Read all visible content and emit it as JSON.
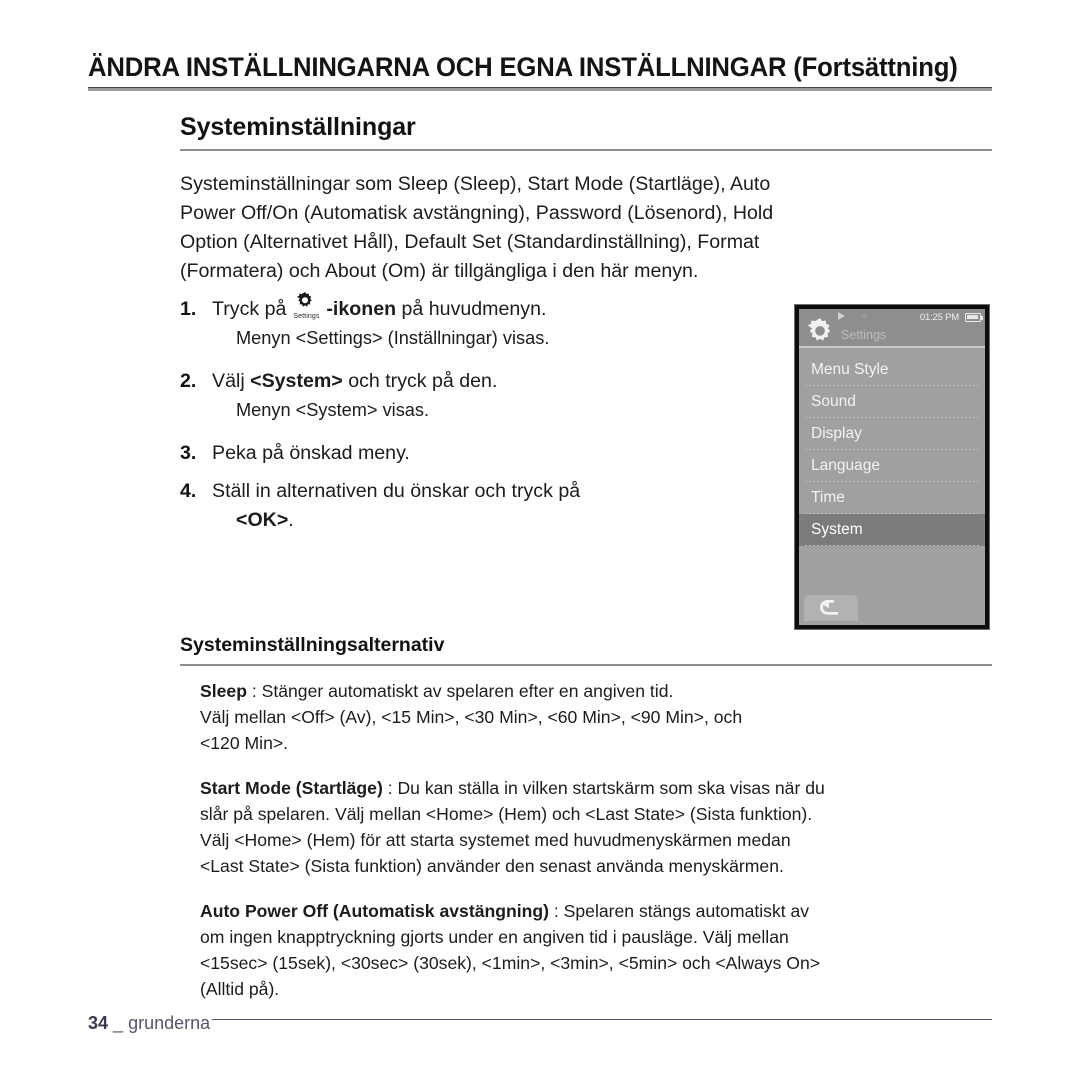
{
  "chapter": {
    "title": "ÄNDRA INSTÄLLNINGARNA OCH EGNA INSTÄLLNINGAR (Fortsättning)"
  },
  "section": {
    "heading": "Systeminställningar",
    "intro_lines": [
      "Systeminställningar som Sleep (Sleep), Start Mode (Startläge), Auto",
      "Power Off/On (Automatisk avstängning), Password (Lösenord), Hold",
      "Option (Alternativet Håll), Default Set (Standardinställning), Format",
      "(Formatera) och About (Om) är tillgängliga i den här menyn."
    ]
  },
  "steps": [
    {
      "num": "1.",
      "text_before": "Tryck på",
      "icon_caption": "Settings",
      "text_bold": "-ikonen",
      "text_after": "på huvudmenyn.",
      "sub": "Menyn <Settings> (Inställningar) visas."
    },
    {
      "num": "2.",
      "text_before": "Välj",
      "text_bold": "<System>",
      "text_after": "och tryck på den.",
      "sub": "Menyn <System> visas."
    },
    {
      "num": "3.",
      "text_before": "Peka på önskad meny.",
      "text_bold": "",
      "text_after": "",
      "sub": ""
    },
    {
      "num": "4.",
      "text_before": "Ställ in alternativen du önskar och tryck på",
      "text_bold": "<OK>",
      "text_after": ".",
      "sub": ""
    }
  ],
  "device": {
    "status": {
      "time": "01:25 PM",
      "play_icon": "play-icon",
      "bluetooth_icon": "bluetooth-icon",
      "battery_icon": "battery-full-icon"
    },
    "screen_title": "Settings",
    "screen_title_icon": "gear-icon",
    "menu_items": [
      {
        "label": "Menu Style",
        "selected": false
      },
      {
        "label": "Sound",
        "selected": false
      },
      {
        "label": "Display",
        "selected": false
      },
      {
        "label": "Language",
        "selected": false
      },
      {
        "label": "Time",
        "selected": false
      },
      {
        "label": "System",
        "selected": true
      }
    ],
    "back_icon": "back-arrow-icon"
  },
  "subsection": {
    "heading": "Systeminställningsalternativ",
    "paragraphs": [
      {
        "term": "Sleep",
        "lines": [
          " : Stänger automatiskt av spelaren efter en angiven tid.",
          "Välj mellan <Off> (Av), <15 Min>, <30 Min>, <60 Min>, <90 Min>, och",
          "<120 Min>."
        ]
      },
      {
        "term": "Start Mode (Startläge)",
        "lines": [
          " : Du kan ställa in vilken startskärm som ska visas när du",
          "slår på spelaren. Välj mellan <Home> (Hem) och <Last State> (Sista funktion).",
          "Välj <Home> (Hem) för att starta systemet med huvudmenyskärmen medan",
          "<Last State> (Sista funktion) använder den senast använda menyskärmen."
        ]
      },
      {
        "term": "Auto Power Off (Automatisk avstängning)",
        "lines": [
          " : Spelaren stängs automatiskt av",
          "om ingen knapptryckning gjorts under en angiven tid i pausläge. Välj mellan",
          "<15sec> (15sek), <30sec> (30sek), <1min>, <3min>, <5min> och <Always On>",
          "(Alltid på)."
        ]
      }
    ]
  },
  "footer": {
    "page_number": "34",
    "dash": "_",
    "label": "grunderna"
  }
}
